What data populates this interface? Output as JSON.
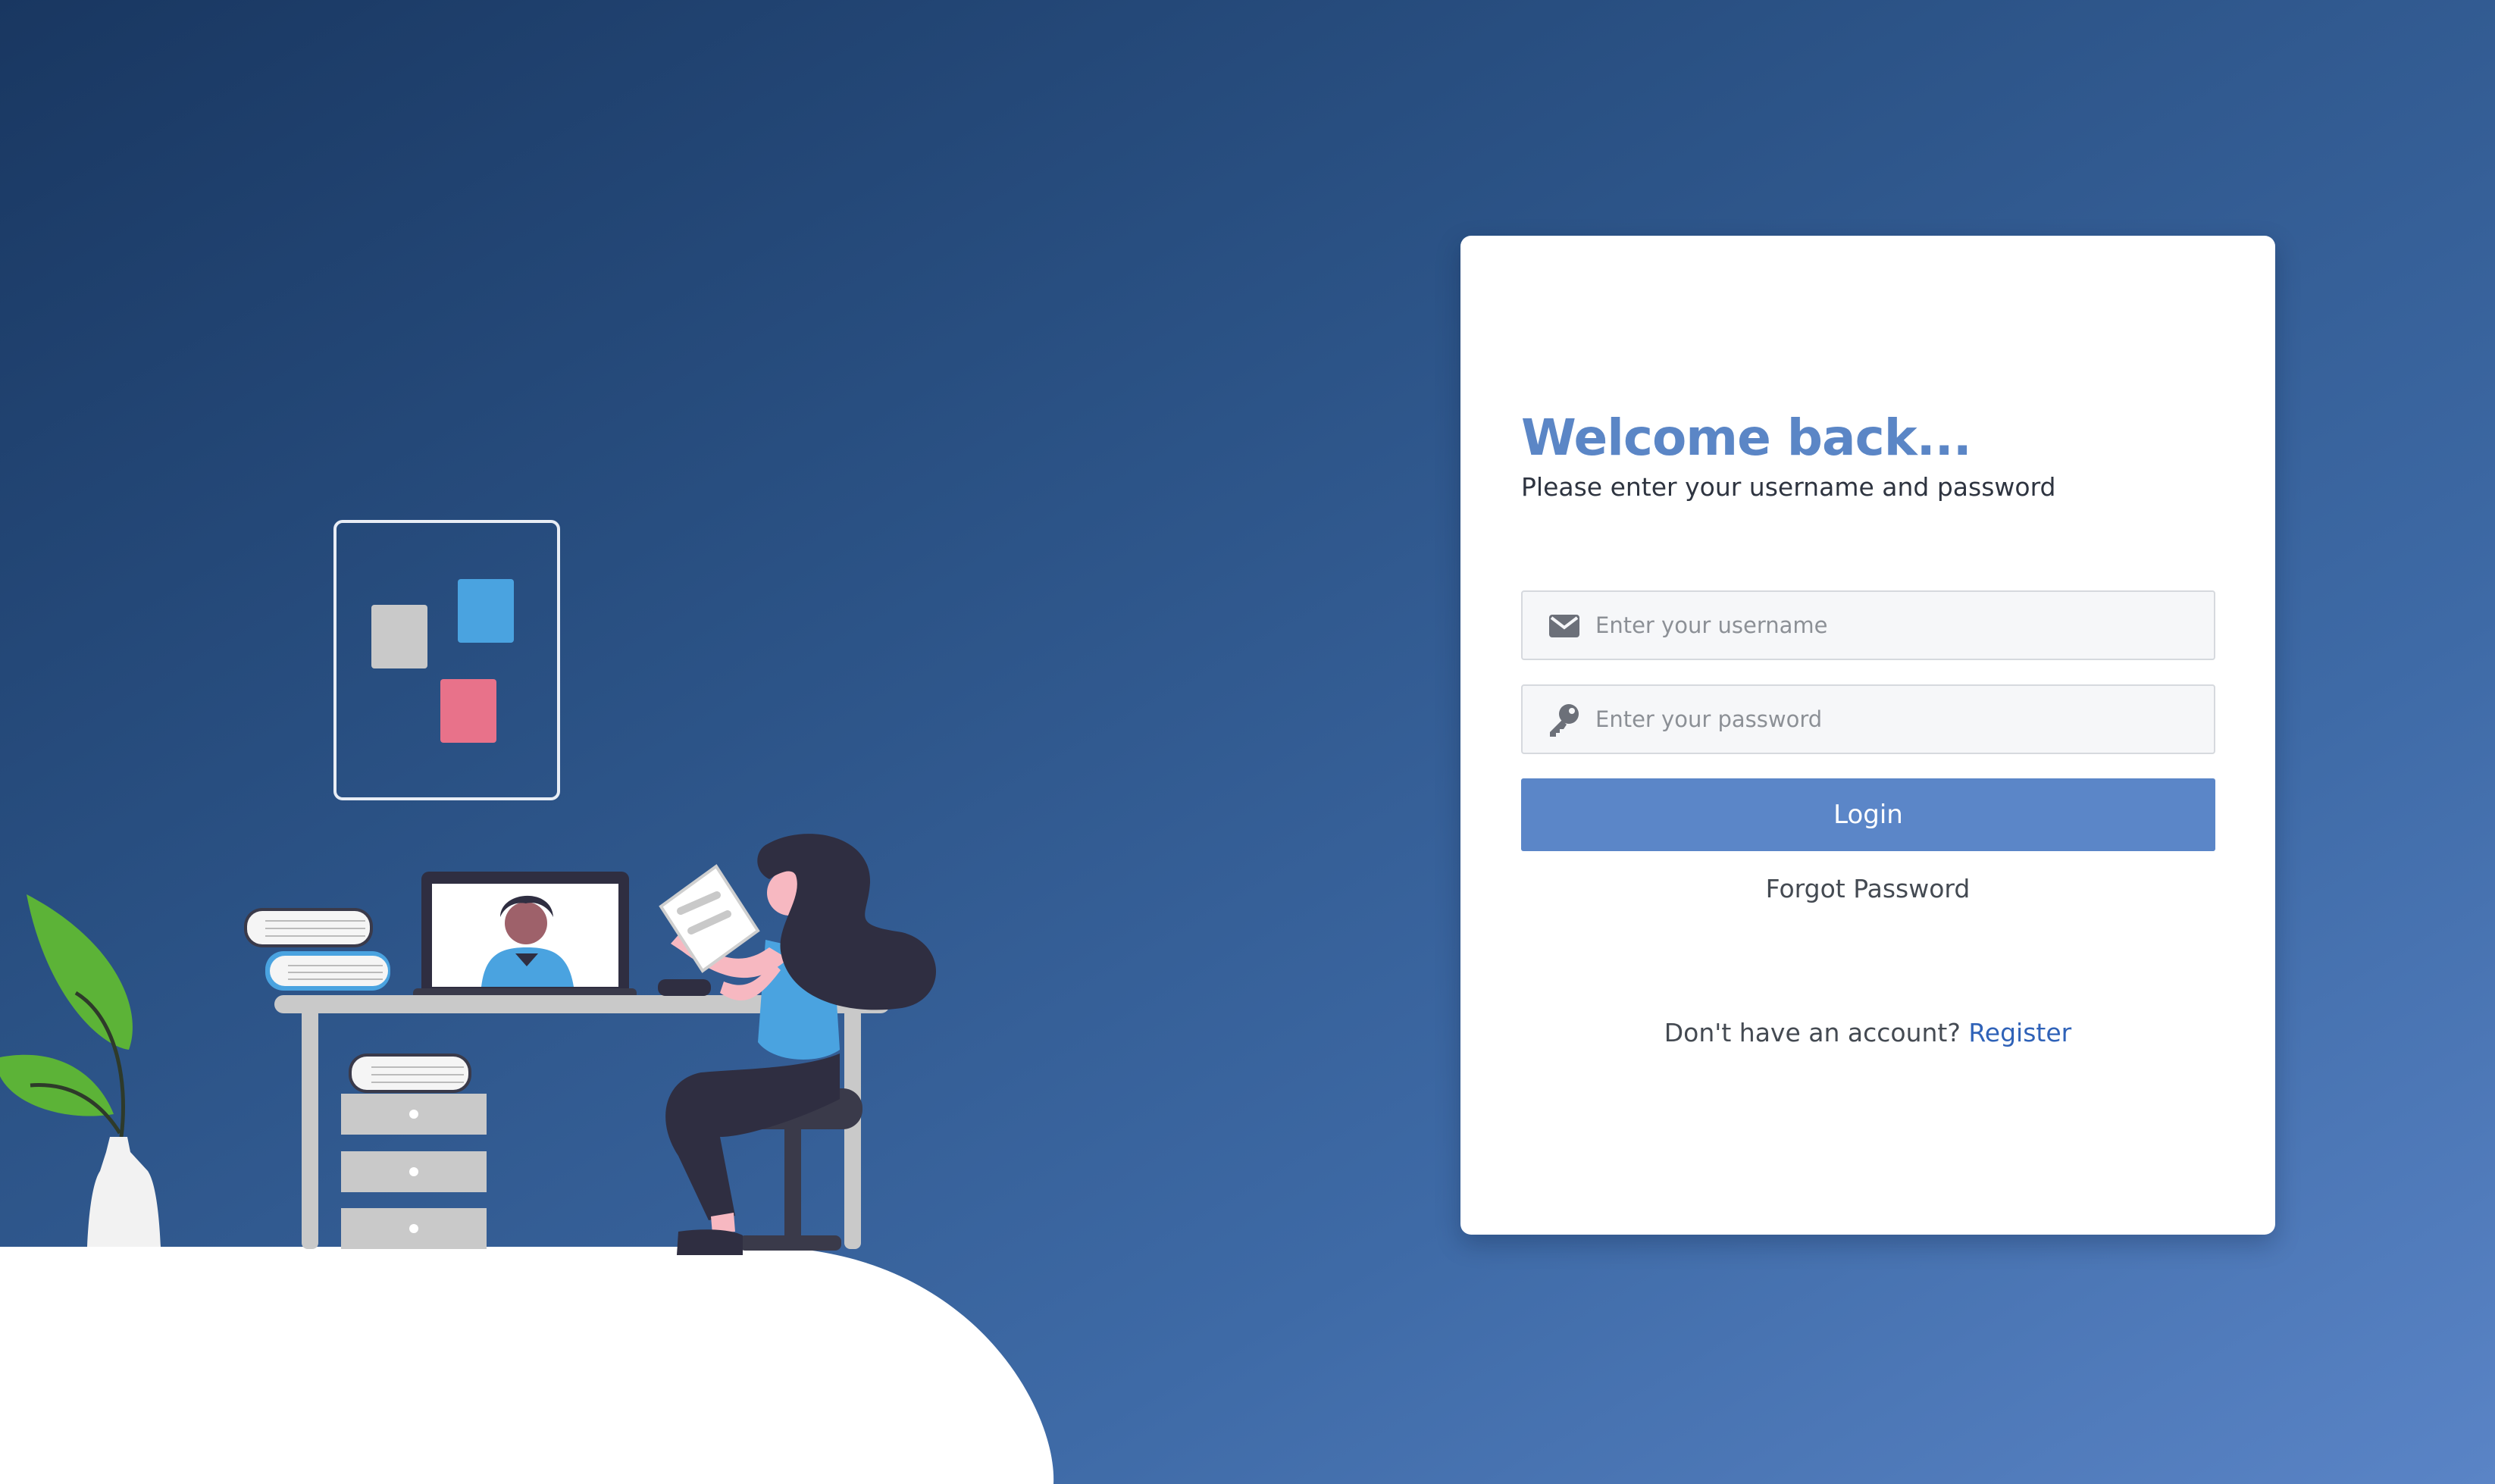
{
  "login": {
    "title": "Welcome back...",
    "subtitle": "Please enter your username and password",
    "username": {
      "placeholder": "Enter your username",
      "value": "",
      "icon": "envelope-icon"
    },
    "password": {
      "placeholder": "Enter your password",
      "value": "",
      "icon": "key-icon"
    },
    "login_button_label": "Login",
    "forgot_password_label": "Forgot Password",
    "no_account_text": "Don't have an account?",
    "register_label": "Register"
  },
  "colors": {
    "background_gradient_start": "#193761",
    "background_gradient_end": "#5a84c6",
    "accent": "#5b86c8",
    "title": "#5b86c6",
    "link": "#2f62b8"
  }
}
